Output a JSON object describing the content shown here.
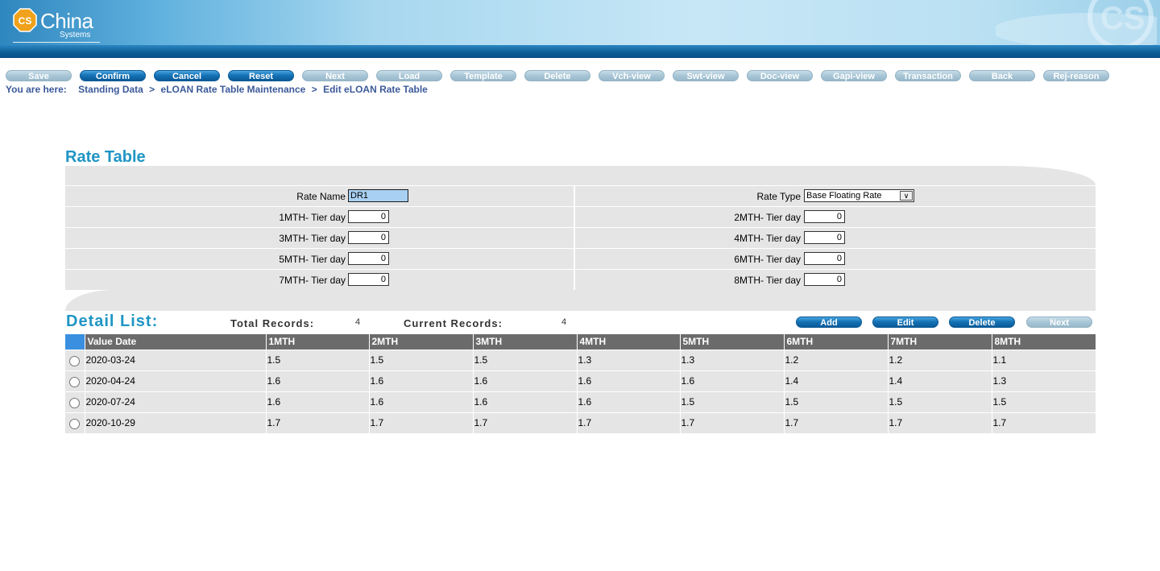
{
  "header": {
    "logo_main": "China",
    "logo_sub": "Systems",
    "logo_badge": "CS"
  },
  "toolbar": [
    {
      "label": "Save",
      "active": false
    },
    {
      "label": "Confirm",
      "active": true
    },
    {
      "label": "Cancel",
      "active": true
    },
    {
      "label": "Reset",
      "active": true
    },
    {
      "label": "Next",
      "active": false
    },
    {
      "label": "Load",
      "active": false
    },
    {
      "label": "Template",
      "active": false
    },
    {
      "label": "Delete",
      "active": false
    },
    {
      "label": "Vch-view",
      "active": false
    },
    {
      "label": "Swt-view",
      "active": false
    },
    {
      "label": "Doc-view",
      "active": false
    },
    {
      "label": "Gapi-view",
      "active": false
    },
    {
      "label": "Transaction",
      "active": false
    },
    {
      "label": "Back",
      "active": false
    },
    {
      "label": "Rej-reason",
      "active": false
    }
  ],
  "breadcrumb": {
    "lead": "You are here:",
    "items": [
      "Standing Data",
      "eLOAN Rate Table Maintenance",
      "Edit eLOAN Rate Table"
    ],
    "separator": ">"
  },
  "rate_table": {
    "title": "Rate Table",
    "rate_name_label": "Rate Name",
    "rate_name_value": "DR1",
    "rate_type_label": "Rate Type",
    "rate_type_value": "Base Floating Rate",
    "tiers": [
      {
        "left_label": "1MTH- Tier day",
        "left_value": "0",
        "right_label": "2MTH- Tier day",
        "right_value": "0"
      },
      {
        "left_label": "3MTH- Tier day",
        "left_value": "0",
        "right_label": "4MTH- Tier day",
        "right_value": "0"
      },
      {
        "left_label": "5MTH- Tier day",
        "left_value": "0",
        "right_label": "6MTH- Tier day",
        "right_value": "0"
      },
      {
        "left_label": "7MTH- Tier day",
        "left_value": "0",
        "right_label": "8MTH- Tier day",
        "right_value": "0"
      }
    ]
  },
  "detail_list": {
    "title": "Detail List:",
    "total_records_label": "Total Records:",
    "total_records_value": "4",
    "current_records_label": "Current Records:",
    "current_records_value": "4",
    "buttons": [
      {
        "label": "Add",
        "enabled": true
      },
      {
        "label": "Edit",
        "enabled": true
      },
      {
        "label": "Delete",
        "enabled": true
      },
      {
        "label": "Next",
        "enabled": false
      }
    ],
    "columns": [
      "Value Date",
      "1MTH",
      "2MTH",
      "3MTH",
      "4MTH",
      "5MTH",
      "6MTH",
      "7MTH",
      "8MTH"
    ],
    "rows": [
      [
        "2020-03-24",
        "1.5",
        "1.5",
        "1.5",
        "1.3",
        "1.3",
        "1.2",
        "1.2",
        "1.1"
      ],
      [
        "2020-04-24",
        "1.6",
        "1.6",
        "1.6",
        "1.6",
        "1.6",
        "1.4",
        "1.4",
        "1.3"
      ],
      [
        "2020-07-24",
        "1.6",
        "1.6",
        "1.6",
        "1.6",
        "1.5",
        "1.5",
        "1.5",
        "1.5"
      ],
      [
        "2020-10-29",
        "1.7",
        "1.7",
        "1.7",
        "1.7",
        "1.7",
        "1.7",
        "1.7",
        "1.7"
      ]
    ]
  },
  "colors": {
    "accent_title": "#1f95c5",
    "breadcrumb": "#3c5a9a",
    "table_header": "#6b6b6b",
    "row_bg": "#e5e5e5"
  }
}
